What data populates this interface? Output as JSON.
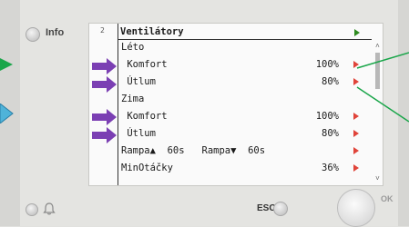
{
  "device": {
    "info_label": "Info",
    "esc_label": "ESC",
    "ok_label": "OK"
  },
  "screen": {
    "page_number": "2",
    "title": "Ventilátory",
    "rows": [
      {
        "label": "Léto",
        "value": "",
        "has_arrow": false
      },
      {
        "label": " Komfort",
        "value": "100%",
        "has_arrow": true
      },
      {
        "label": " Útlum",
        "value": "80%",
        "has_arrow": true
      },
      {
        "label": "Zima",
        "value": "",
        "has_arrow": false
      },
      {
        "label": " Komfort",
        "value": "100%",
        "has_arrow": true
      },
      {
        "label": " Útlum",
        "value": "80%",
        "has_arrow": true
      },
      {
        "label": "Rampa▲  60s   Rampa▼  60s",
        "value": "",
        "has_arrow": true
      },
      {
        "label": "MinOtáčky",
        "value": "36%",
        "has_arrow": true
      }
    ]
  },
  "colors": {
    "play_green": "#2e8b1f",
    "arrow_red": "#e0443a",
    "pointer_purple": "#7b3fb3",
    "callout_green": "#1aa64a",
    "callout_cyan": "#4fb3d9"
  }
}
